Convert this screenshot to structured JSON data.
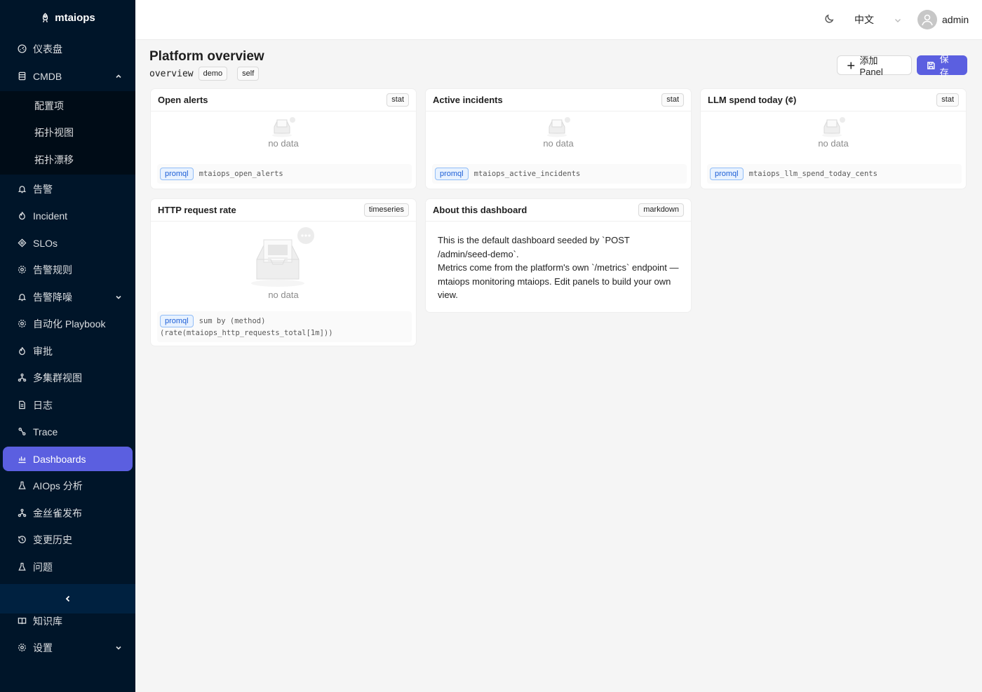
{
  "app": {
    "name": "mtaiops"
  },
  "sidebar": {
    "items": [
      {
        "label": "仪表盘",
        "icon": "dashboard-gauge-icon"
      },
      {
        "label": "CMDB",
        "icon": "database-icon",
        "expanded": true
      },
      {
        "label": "配置项"
      },
      {
        "label": "拓扑视图"
      },
      {
        "label": "拓扑漂移"
      },
      {
        "label": "告警",
        "icon": "bell-icon"
      },
      {
        "label": "Incident",
        "icon": "fire-icon"
      },
      {
        "label": "SLOs",
        "icon": "target-icon"
      },
      {
        "label": "告警规则",
        "icon": "gear-icon"
      },
      {
        "label": "告警降噪",
        "icon": "bell-icon",
        "expanded": false
      },
      {
        "label": "自动化 Playbook",
        "icon": "gear-icon"
      },
      {
        "label": "审批",
        "icon": "fire-icon"
      },
      {
        "label": "多集群视图",
        "icon": "cluster-icon"
      },
      {
        "label": "日志",
        "icon": "file-icon"
      },
      {
        "label": "Trace",
        "icon": "trace-icon"
      },
      {
        "label": "Dashboards",
        "icon": "bar-chart-icon",
        "active": true
      },
      {
        "label": "AIOps 分析",
        "icon": "flask-icon"
      },
      {
        "label": "金丝雀发布",
        "icon": "cluster-icon"
      },
      {
        "label": "变更历史",
        "icon": "history-icon"
      },
      {
        "label": "问题",
        "icon": "flask-icon"
      },
      {
        "label": "知识库",
        "icon": "book-icon"
      },
      {
        "label": "设置",
        "icon": "gear-icon",
        "expanded": false
      }
    ]
  },
  "header": {
    "language": "中文",
    "username": "admin"
  },
  "page": {
    "title": "Platform overview",
    "slug": "overview",
    "tags": [
      "demo",
      "self"
    ],
    "add_panel_label": "添加 Panel",
    "save_label": "保存"
  },
  "panels": [
    {
      "title": "Open alerts",
      "type": "stat",
      "empty": "no data",
      "lang": "promql",
      "query": "mtaiops_open_alerts"
    },
    {
      "title": "Active incidents",
      "type": "stat",
      "empty": "no data",
      "lang": "promql",
      "query": "mtaiops_active_incidents"
    },
    {
      "title": "LLM spend today (¢)",
      "type": "stat",
      "empty": "no data",
      "lang": "promql",
      "query": "mtaiops_llm_spend_today_cents"
    },
    {
      "title": "HTTP request rate",
      "type": "timeseries",
      "empty": "no data",
      "lang": "promql",
      "query": "sum by (method) (rate(mtaiops_http_requests_total[1m]))"
    },
    {
      "title": "About this dashboard",
      "type": "markdown",
      "content": "This is the default dashboard seeded by `POST /admin/seed-demo`.\nMetrics come from the platform's own `/metrics` endpoint — mtaiops monitoring mtaiops. Edit panels to build your own view."
    }
  ],
  "colors": {
    "sidebar_bg": "#001529",
    "submenu_bg": "#000c17",
    "accent": "#5b5fe0",
    "promql_tag": "#1d5fd6"
  }
}
